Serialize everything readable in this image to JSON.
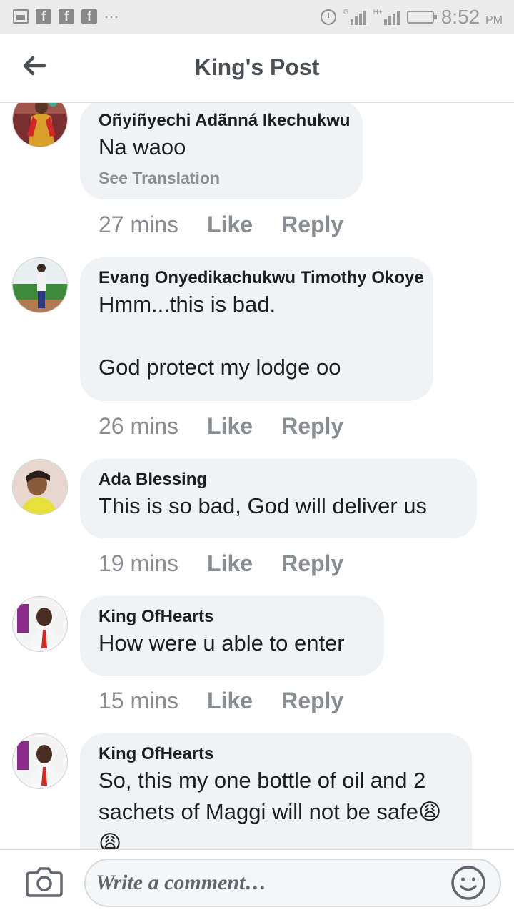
{
  "status_bar": {
    "time": "8:52",
    "ampm": "PM",
    "network_label": "G",
    "network_label_2": "H+"
  },
  "header": {
    "title": "King's Post"
  },
  "comments": [
    {
      "author": "Oñyiñyechi Adãnná Ikechukwu",
      "text": "Na waoo",
      "see_translation": "See Translation",
      "time": "27 mins",
      "like": "Like",
      "reply": "Reply"
    },
    {
      "author": "Evang Onyedikachukwu Timothy Okoye",
      "text": "Hmm...this is bad.\n\nGod protect my lodge oo",
      "time": "26 mins",
      "like": "Like",
      "reply": "Reply"
    },
    {
      "author": "Ada Blessing",
      "text": "This is so bad, God will deliver us",
      "time": "19 mins",
      "like": "Like",
      "reply": "Reply"
    },
    {
      "author": "King OfHearts",
      "text": "How were u able to enter",
      "time": "15 mins",
      "like": "Like",
      "reply": "Reply"
    },
    {
      "author": "King OfHearts",
      "text": "So, this my one bottle of oil and 2 sachets of Maggi will not be safe😩😩"
    }
  ],
  "composer": {
    "placeholder": "Write a comment…"
  },
  "icons": [
    "image-icon",
    "facebook-icon",
    "more-icon",
    "alarm-icon",
    "signal-icon",
    "battery-icon",
    "back-arrow-icon",
    "camera-icon",
    "emoji-icon"
  ]
}
